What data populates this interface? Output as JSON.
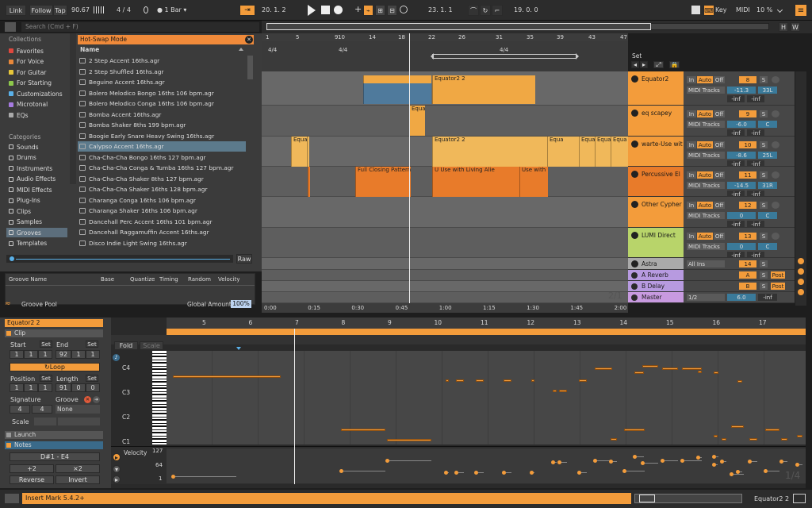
{
  "transport": {
    "link": "Link",
    "follow": "Follow",
    "tap": "Tap",
    "tempo": "90.67",
    "signature": "4 / 4",
    "quantize": "1 Bar",
    "pos1": "20.  1.  2",
    "pos2": "23.  1.  1",
    "pos3": "19.  0.  0",
    "key": "Key",
    "midi": "MIDI",
    "cpu": "10 %"
  },
  "browser": {
    "search_placeholder": "Search (Cmd + F)",
    "collections_label": "Collections",
    "collections": [
      {
        "label": "Favorites",
        "color": "#e0483e"
      },
      {
        "label": "For Voice",
        "color": "#e8883a"
      },
      {
        "label": "For Guitar",
        "color": "#e8c73a"
      },
      {
        "label": "For Starting",
        "color": "#8dc84b"
      },
      {
        "label": "Customizations",
        "color": "#5ab0e8"
      },
      {
        "label": "Microtonal",
        "color": "#a67be0"
      },
      {
        "label": "EQs",
        "color": "#aaaaaa"
      }
    ],
    "categories_label": "Categories",
    "categories": [
      "Sounds",
      "Drums",
      "Instruments",
      "Audio Effects",
      "MIDI Effects",
      "Plug-Ins",
      "Clips",
      "Samples",
      "Grooves",
      "Templates"
    ],
    "hotswap": "Hot-Swap Mode",
    "name_header": "Name",
    "files": [
      "2 Step Accent 16ths.agr",
      "2 Step Shuffled 16ths.agr",
      "Beguine Accent 16ths.agr",
      "Bolero Melodico Bongo 16ths 106 bpm.agr",
      "Bolero Melodico Conga 16ths 106 bpm.agr",
      "Bomba Accent 16ths.agr",
      "Bomba Shaker 8ths 199 bpm.agr",
      "Boogie Early Snare Heavy Swing 16ths.agr",
      "Calypso Accent 16ths.agr",
      "Cha-Cha-Cha Bongo 16ths 127 bpm.agr",
      "Cha-Cha-Cha Conga & Tumba 16ths 127 bpm.agr",
      "Cha-Cha-Cha Shaker 8ths 127 bpm.agr",
      "Cha-Cha-Cha Shaker 16ths 128 bpm.agr",
      "Charanga Conga 16ths 106 bpm.agr",
      "Charanga Shaker 16ths 106 bpm.agr",
      "Dancehall Perc Accent 16ths 101 bpm.agr",
      "Dancehall Raggamuffin Accent 16ths.agr",
      "Disco Indie Light Swing 16ths.agr"
    ],
    "raw": "Raw",
    "groove_cols": [
      "Groove Name",
      "Base",
      "Quantize",
      "Timing",
      "Random",
      "Velocity"
    ],
    "groove_pool": "Groove Pool",
    "global_amount_label": "Global Amount",
    "global_amount": "100%"
  },
  "arrangement": {
    "bars": [
      "1",
      "5",
      "9",
      "10",
      "14",
      "18",
      "22",
      "26",
      "31",
      "35",
      "39",
      "43",
      "47"
    ],
    "sig_marks": [
      "4/4",
      "4/4",
      "4/4"
    ],
    "set_label": "Set",
    "times": [
      "0:00",
      "0:15",
      "0:30",
      "0:45",
      "1:00",
      "1:15",
      "1:30",
      "1:45",
      "2:00"
    ],
    "page": "2/1"
  },
  "clips": [
    {
      "label": "Equator2 2",
      "color": "#f0a844"
    },
    {
      "label": "Equator2 2",
      "color": "#f0a844"
    },
    {
      "label": "Equa",
      "color": "#f0a844"
    },
    {
      "label": "Equa",
      "color": "#f0b85a"
    },
    {
      "label": "Equator2 2",
      "color": "#f0b85a"
    },
    {
      "label": "Equa",
      "color": "#f0b85a"
    },
    {
      "label": "Equa",
      "color": "#f0b85a"
    },
    {
      "label": "Equa",
      "color": "#f0b85a"
    },
    {
      "label": "Equa",
      "color": "#f0b85a"
    },
    {
      "label": "Full Closing Pattern",
      "color": "#e87b2a"
    },
    {
      "label": "U Use with Living Alie",
      "color": "#e87b2a"
    },
    {
      "label": "Use with Living Alie",
      "color": "#e87b2a"
    }
  ],
  "tracks": [
    {
      "name": "Equator2",
      "color": "#f39c3b",
      "vol": "-11.3",
      "pan": "33L",
      "num": "8",
      "in": "In",
      "auto": "Auto",
      "off": "Off",
      "s": "S",
      "route": "MIDI Tracks",
      "inf1": "-inf",
      "inf2": "-inf"
    },
    {
      "name": "eq scapey",
      "color": "#f39c3b",
      "vol": "-6.0",
      "pan": "C",
      "num": "9",
      "in": "In",
      "auto": "Auto",
      "off": "Off",
      "s": "S",
      "route": "MIDI Tracks",
      "inf1": "-inf",
      "inf2": "-inf"
    },
    {
      "name": "warte-Use wit",
      "color": "#f39c3b",
      "vol": "-8.6",
      "pan": "25L",
      "num": "10",
      "in": "In",
      "auto": "Auto",
      "off": "Off",
      "s": "S",
      "route": "MIDI Tracks",
      "inf1": "-inf",
      "inf2": "-inf"
    },
    {
      "name": "Percussive El",
      "color": "#e87b2a",
      "vol": "-14.5",
      "pan": "31R",
      "num": "11",
      "in": "In",
      "auto": "Auto",
      "off": "Off",
      "s": "S",
      "route": "MIDI Tracks",
      "inf1": "-inf",
      "inf2": "-inf"
    },
    {
      "name": "Other Cypher",
      "color": "#f39c3b",
      "vol": "0",
      "pan": "C",
      "num": "12",
      "in": "In",
      "auto": "Auto",
      "off": "Off",
      "s": "S",
      "route": "MIDI Tracks",
      "inf1": "-inf",
      "inf2": "-inf"
    },
    {
      "name": "LUMI Direct",
      "color": "#b8d46a",
      "vol": "0",
      "pan": "C",
      "num": "13",
      "in": "In",
      "auto": "Auto",
      "off": "Off",
      "s": "S",
      "route": "MIDI Tracks",
      "inf1": "-inf",
      "inf2": "-inf"
    }
  ],
  "group": {
    "name": "Astra",
    "route": "All Ins",
    "num": "14",
    "s": "S",
    "inf1": "-inf",
    "inf2": "-inf"
  },
  "returns": [
    {
      "name": "A Reverb",
      "letter": "A",
      "s": "S",
      "post": "Post"
    },
    {
      "name": "B Delay",
      "letter": "B",
      "s": "S",
      "post": "Post"
    }
  ],
  "master": {
    "name": "Master",
    "route": "1/2",
    "vol": "6.0",
    "inf": "-inf"
  },
  "clipview": {
    "title": "Equator2 2",
    "clip_label": "Clip",
    "start_label": "Start",
    "end_label": "End",
    "set": "Set",
    "start": [
      "1",
      "1",
      "1"
    ],
    "end": [
      "92",
      "1",
      "1"
    ],
    "loop": "Loop",
    "position_label": "Position",
    "length_label": "Length",
    "position": [
      "1",
      "1",
      "1"
    ],
    "length": [
      "91",
      "0",
      "0"
    ],
    "signature_label": "Signature",
    "groove_label": "Groove",
    "sig_num": "4",
    "sig_den": "4",
    "groove_value": "None",
    "scale_label": "Scale",
    "launch_label": "Launch",
    "notes_label": "Notes",
    "note_range": "D#1 - E4",
    "plus2": "+2",
    "times2": "×2",
    "reverse": "Reverse",
    "invert": "Invert"
  },
  "editor": {
    "fold": "Fold",
    "scale": "Scale",
    "keys": [
      "C4",
      "C3",
      "C2",
      "C1"
    ],
    "bars": [
      "5",
      "6",
      "7",
      "8",
      "9",
      "10",
      "11",
      "12",
      "13",
      "14",
      "15",
      "16",
      "17"
    ],
    "velocity": "Velocity",
    "vel_ticks": [
      "127",
      "64",
      "1"
    ],
    "page": "1/4"
  },
  "status": {
    "message": "Insert Mark 5.4.2+",
    "track": "Equator2 2"
  }
}
